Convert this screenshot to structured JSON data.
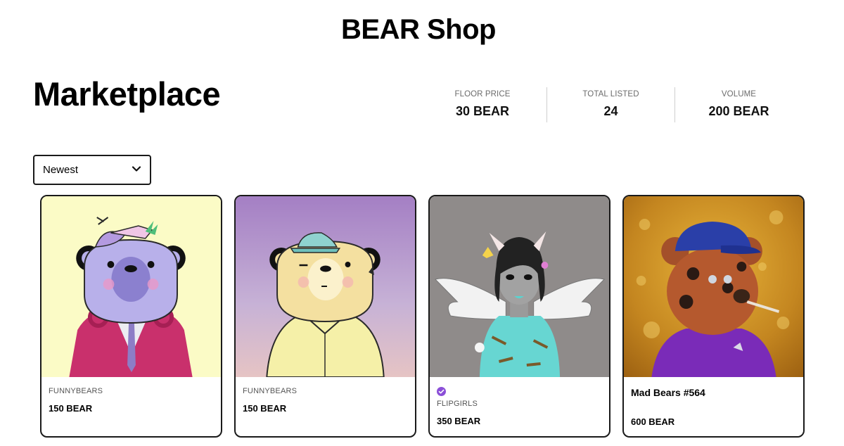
{
  "header": {
    "title": "BEAR Shop"
  },
  "page": {
    "title": "Marketplace"
  },
  "stats": [
    {
      "label": "FLOOR PRICE",
      "value": "30 BEAR"
    },
    {
      "label": "TOTAL LISTED",
      "value": "24"
    },
    {
      "label": "VOLUME",
      "value": "200 BEAR"
    }
  ],
  "sort": {
    "selected": "Newest",
    "icon": "chevron-down-icon"
  },
  "listings": [
    {
      "collection": "FUNNYBEARS",
      "price": "150 BEAR",
      "background": "#fbfbc6",
      "art": "purple-bear-propeller-cap"
    },
    {
      "collection": "FUNNYBEARS",
      "price": "150 BEAR",
      "background": "#b49acb",
      "art": "yellow-bear-teal-hat"
    },
    {
      "collection": "FLIPGIRLS",
      "price": "350 BEAR",
      "verified": true,
      "background": "#8f8b8a",
      "art": "winged-girl-horns"
    },
    {
      "name": "Mad Bears #564",
      "price": "600 BEAR",
      "background": "#c88a1e",
      "art": "brown-bear-blue-cap"
    }
  ],
  "colors": {
    "accent": "#8b4fd8",
    "border": "#1a1a1a"
  }
}
